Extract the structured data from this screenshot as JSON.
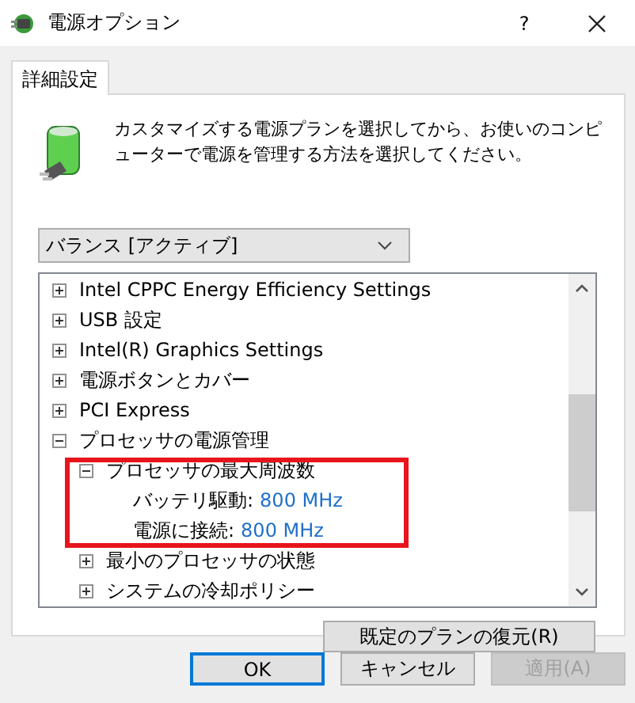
{
  "window": {
    "title": "電源オプション",
    "help": "?"
  },
  "tabs": [
    {
      "label": "詳細設定",
      "selected": true
    }
  ],
  "description": "カスタマイズする電源プランを選択してから、お使いのコンピューターで電源を管理する方法を選択してください。",
  "plan_dropdown": {
    "value": "バランス [アクティブ]"
  },
  "tree": [
    {
      "label": "Intel CPPC Energy Efficiency Settings",
      "expanded": false
    },
    {
      "label": "USB 設定",
      "expanded": false
    },
    {
      "label": "Intel(R) Graphics Settings",
      "expanded": false
    },
    {
      "label": "電源ボタンとカバー",
      "expanded": false
    },
    {
      "label": "PCI Express",
      "expanded": false
    },
    {
      "label": "プロセッサの電源管理",
      "expanded": true,
      "children": [
        {
          "label": "プロセッサの最大周波数",
          "expanded": true,
          "children": [
            {
              "kind": "setting",
              "label": "バッテリ駆動:",
              "value": "800 MHz"
            },
            {
              "kind": "setting",
              "label": "電源に接続:",
              "value": "800 MHz"
            }
          ]
        },
        {
          "label": "最小のプロセッサの状態",
          "expanded": false
        },
        {
          "label": "システムの冷却ポリシー",
          "expanded": false
        }
      ]
    }
  ],
  "restore_button": "既定のプランの復元(R)",
  "buttons": [
    {
      "label": "OK",
      "kind": "default",
      "disabled": false
    },
    {
      "label": "キャンセル",
      "kind": "normal",
      "disabled": false
    },
    {
      "label": "適用(A)",
      "kind": "normal",
      "disabled": true
    }
  ]
}
